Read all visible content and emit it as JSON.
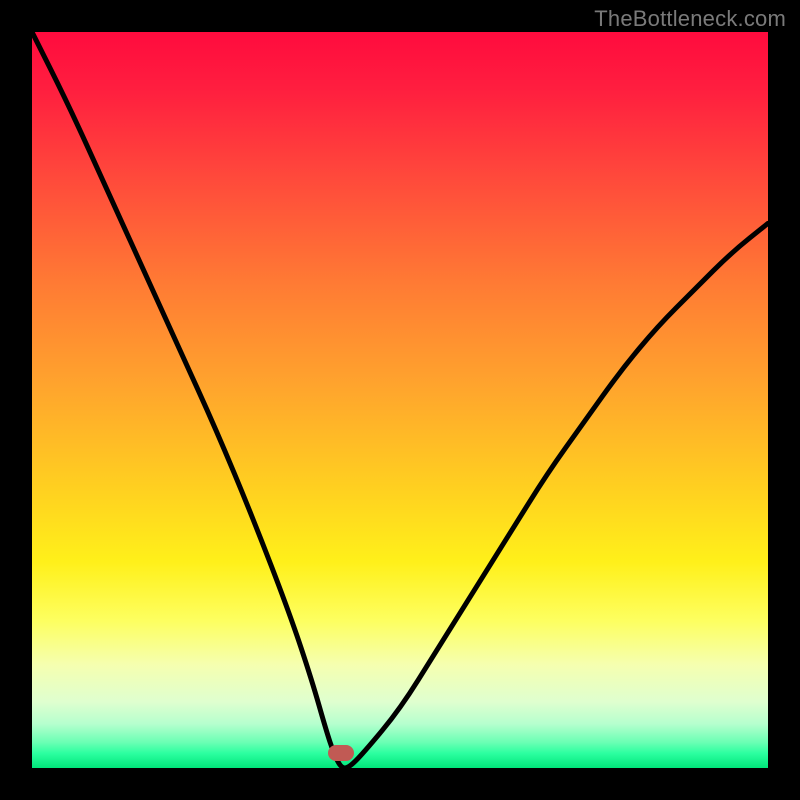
{
  "watermark": "TheBottleneck.com",
  "colors": {
    "curve": "#000000",
    "marker": "#c15a54",
    "frame": "#000000"
  },
  "chart_data": {
    "type": "line",
    "title": "",
    "xlabel": "",
    "ylabel": "",
    "xlim": [
      0,
      100
    ],
    "ylim": [
      0,
      100
    ],
    "grid": false,
    "series": [
      {
        "name": "bottleneck-curve",
        "x": [
          0,
          5,
          10,
          15,
          20,
          25,
          30,
          35,
          38,
          40,
          41,
          42,
          43,
          45,
          50,
          55,
          60,
          65,
          70,
          75,
          80,
          85,
          90,
          95,
          100
        ],
        "values": [
          100,
          90,
          79,
          68,
          57,
          46,
          34,
          21,
          12,
          5,
          2,
          0,
          0,
          2,
          8,
          16,
          24,
          32,
          40,
          47,
          54,
          60,
          65,
          70,
          74
        ]
      }
    ],
    "annotations": [
      {
        "name": "optimal-marker",
        "x": 42,
        "y": 2,
        "shape": "pill",
        "color": "#c15a54"
      }
    ]
  }
}
